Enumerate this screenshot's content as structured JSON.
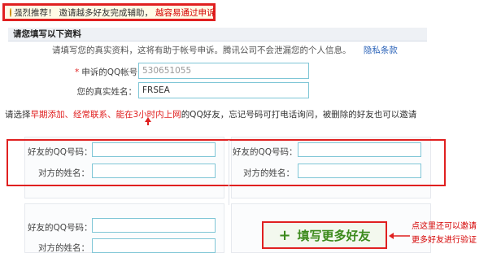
{
  "notice": {
    "prefix": "强烈推荐！",
    "text": "邀请越多好友完成辅助，",
    "highlight": "越容易通过申诉"
  },
  "section": {
    "title": "请您填写以下资料"
  },
  "description": {
    "text": "请填写您的真实资料，这将有助于帐号申诉。腾讯公司不会泄漏您的个人信息。",
    "privacy_link": "隐私条款"
  },
  "form": {
    "qq_label": "申诉的QQ帐号：",
    "qq_value": "530651055",
    "name_label": "您的真实姓名：",
    "name_value": "FRSEA"
  },
  "hint": {
    "pre": "请选择",
    "red": "早期添加、经常联系、能在3小时内上网",
    "post": "的QQ好友，忘记号码可打电话询问，被删除的好友也可以邀请"
  },
  "friends": {
    "qq_label": "好友的QQ号码：",
    "name_label": "对方的姓名："
  },
  "add_button": {
    "icon": "plus-icon",
    "label": "填写更多好友"
  },
  "annotation": {
    "line1": "点这里还可以邀请",
    "line2": "更多好友进行验证"
  },
  "colors": {
    "highlight_red": "#e02020",
    "link_blue": "#2a62b8",
    "button_green": "#3c8a1c",
    "input_border": "#7fc6d6"
  }
}
